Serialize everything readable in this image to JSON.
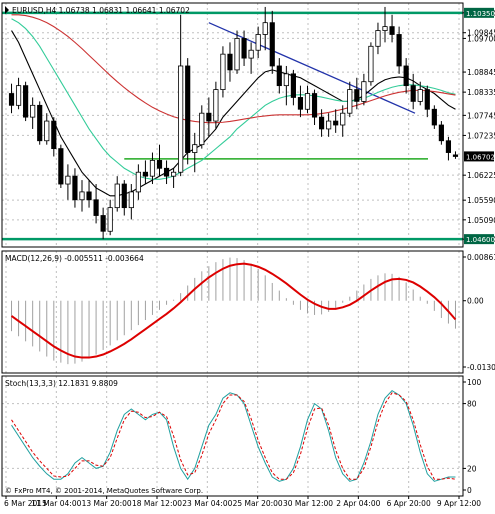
{
  "colors": {
    "background": "#ffffff",
    "frame": "#000000",
    "grid": "#c0c0c0",
    "bull_candle": "#ffffff",
    "bear_candle": "#000000",
    "ma_fast": "#000000",
    "ma_mid": "#33cc99",
    "ma_slow": "#cc3333",
    "trend_line": "#2233aa",
    "horizontal_levels": "#009966",
    "support_line": "#22aa22",
    "macd_histogram": "#a0a0a0",
    "macd_signal": "#dd0000",
    "stoch_main": "#20a0a0",
    "stoch_signal": "#dd0000",
    "price_label_bg": "#006644",
    "price_label_text": "#ffffff"
  },
  "chart_data": [
    {
      "type": "candlestick",
      "title": "EURUSD,H4  1.06738 1.06831 1.06641 1.06702",
      "symbol": "EURUSD",
      "timeframe": "H4",
      "ohlc_last": {
        "open": 1.06738,
        "high": 1.06831,
        "low": 1.06641,
        "close": 1.06702
      },
      "ylim": [
        1.044,
        1.106
      ],
      "yticks": [
        "1.10350",
        "1.09845",
        "1.09700",
        "1.08845",
        "1.08335",
        "1.07745",
        "1.07235",
        "1.06225",
        "1.05590",
        "1.05090",
        "1.04600"
      ],
      "xtick_labels": [
        "6 Mar 2015",
        "11 Mar 04:00",
        "13 Mar 20:00",
        "18 Mar 12:00",
        "23 Mar 04:00",
        "25 Mar 20:00",
        "30 Mar 12:00",
        "2 Apr 04:00",
        "6 Apr 20:00",
        "9 Apr 12:00"
      ],
      "grid": true,
      "horizontal_levels": [
        1.1035,
        1.046
      ],
      "support_level": 1.0664,
      "trend_line": {
        "from": 1.101,
        "to": 1.078
      },
      "candles": [
        [
          1.083,
          1.0855,
          1.078,
          1.08
        ],
        [
          1.08,
          1.087,
          1.079,
          1.085
        ],
        [
          1.085,
          1.086,
          1.076,
          1.077
        ],
        [
          1.077,
          1.082,
          1.074,
          1.08
        ],
        [
          1.08,
          1.081,
          1.07,
          1.071
        ],
        [
          1.071,
          1.078,
          1.07,
          1.076
        ],
        [
          1.076,
          1.077,
          1.067,
          1.069
        ],
        [
          1.069,
          1.07,
          1.059,
          1.06
        ],
        [
          1.06,
          1.065,
          1.056,
          1.062
        ],
        [
          1.062,
          1.064,
          1.054,
          1.056
        ],
        [
          1.056,
          1.061,
          1.053,
          1.058
        ],
        [
          1.058,
          1.061,
          1.054,
          1.056
        ],
        [
          1.056,
          1.06,
          1.05,
          1.052
        ],
        [
          1.052,
          1.054,
          1.046,
          1.048
        ],
        [
          1.048,
          1.056,
          1.047,
          1.054
        ],
        [
          1.054,
          1.062,
          1.053,
          1.06
        ],
        [
          1.06,
          1.061,
          1.052,
          1.054
        ],
        [
          1.054,
          1.06,
          1.051,
          1.058
        ],
        [
          1.058,
          1.065,
          1.056,
          1.063
        ],
        [
          1.063,
          1.066,
          1.06,
          1.062
        ],
        [
          1.062,
          1.068,
          1.06,
          1.066
        ],
        [
          1.066,
          1.07,
          1.062,
          1.064
        ],
        [
          1.064,
          1.066,
          1.06,
          1.062
        ],
        [
          1.062,
          1.064,
          1.059,
          1.063
        ],
        [
          1.063,
          1.103,
          1.062,
          1.09
        ],
        [
          1.09,
          1.092,
          1.065,
          1.068
        ],
        [
          1.068,
          1.073,
          1.063,
          1.07
        ],
        [
          1.07,
          1.08,
          1.069,
          1.078
        ],
        [
          1.078,
          1.082,
          1.072,
          1.076
        ],
        [
          1.076,
          1.086,
          1.074,
          1.084
        ],
        [
          1.084,
          1.095,
          1.082,
          1.093
        ],
        [
          1.093,
          1.096,
          1.086,
          1.089
        ],
        [
          1.089,
          1.099,
          1.088,
          1.097
        ],
        [
          1.097,
          1.099,
          1.09,
          1.092
        ],
        [
          1.092,
          1.096,
          1.088,
          1.094
        ],
        [
          1.094,
          1.1,
          1.092,
          1.098
        ],
        [
          1.098,
          1.105,
          1.094,
          1.101
        ],
        [
          1.101,
          1.104,
          1.088,
          1.09
        ],
        [
          1.09,
          1.092,
          1.083,
          1.085
        ],
        [
          1.085,
          1.09,
          1.08,
          1.088
        ],
        [
          1.088,
          1.089,
          1.08,
          1.082
        ],
        [
          1.082,
          1.085,
          1.077,
          1.079
        ],
        [
          1.079,
          1.085,
          1.078,
          1.083
        ],
        [
          1.083,
          1.084,
          1.075,
          1.077
        ],
        [
          1.077,
          1.079,
          1.072,
          1.074
        ],
        [
          1.074,
          1.078,
          1.072,
          1.076
        ],
        [
          1.076,
          1.079,
          1.073,
          1.075
        ],
        [
          1.075,
          1.08,
          1.072,
          1.078
        ],
        [
          1.078,
          1.086,
          1.077,
          1.084
        ],
        [
          1.084,
          1.087,
          1.079,
          1.081
        ],
        [
          1.081,
          1.088,
          1.08,
          1.086
        ],
        [
          1.086,
          1.096,
          1.085,
          1.095
        ],
        [
          1.095,
          1.101,
          1.093,
          1.099
        ],
        [
          1.099,
          1.105,
          1.096,
          1.1
        ],
        [
          1.1,
          1.103,
          1.096,
          1.098
        ],
        [
          1.098,
          1.1,
          1.088,
          1.09
        ],
        [
          1.09,
          1.092,
          1.083,
          1.085
        ],
        [
          1.085,
          1.088,
          1.079,
          1.081
        ],
        [
          1.081,
          1.086,
          1.08,
          1.084
        ],
        [
          1.084,
          1.085,
          1.077,
          1.079
        ],
        [
          1.079,
          1.08,
          1.074,
          1.075
        ],
        [
          1.075,
          1.076,
          1.07,
          1.071
        ],
        [
          1.071,
          1.072,
          1.066,
          1.068
        ],
        [
          1.0674,
          1.0683,
          1.0664,
          1.067
        ]
      ],
      "overlays": [
        {
          "name": "ma_fast",
          "values": [
            1.099,
            1.096,
            1.092,
            1.088,
            1.084,
            1.08,
            1.076,
            1.072,
            1.069,
            1.066,
            1.063,
            1.061,
            1.059,
            1.058,
            1.057,
            1.057,
            1.0575,
            1.058,
            1.059,
            1.06,
            1.061,
            1.062,
            1.063,
            1.064,
            1.066,
            1.068,
            1.069,
            1.07,
            1.072,
            1.074,
            1.077,
            1.079,
            1.081,
            1.083,
            1.085,
            1.087,
            1.0885,
            1.089,
            1.0885,
            1.088,
            1.0875,
            1.087,
            1.086,
            1.085,
            1.084,
            1.083,
            1.082,
            1.081,
            1.081,
            1.0815,
            1.0825,
            1.084,
            1.0855,
            1.0865,
            1.087,
            1.0872,
            1.087,
            1.0862,
            1.085,
            1.084,
            1.083,
            1.0815,
            1.08,
            1.079
          ]
        },
        {
          "name": "ma_mid",
          "values": [
            1.102,
            1.101,
            1.0995,
            1.0975,
            1.095,
            1.092,
            1.089,
            1.086,
            1.083,
            1.08,
            1.077,
            1.074,
            1.0715,
            1.069,
            1.067,
            1.0655,
            1.064,
            1.063,
            1.062,
            1.0615,
            1.0612,
            1.0612,
            1.0615,
            1.062,
            1.063,
            1.064,
            1.065,
            1.066,
            1.0675,
            1.069,
            1.0705,
            1.072,
            1.074,
            1.0755,
            1.077,
            1.0785,
            1.08,
            1.081,
            1.0818,
            1.0823,
            1.0826,
            1.0827,
            1.0826,
            1.0824,
            1.0821,
            1.0817,
            1.0813,
            1.081,
            1.081,
            1.0813,
            1.0818,
            1.0825,
            1.0833,
            1.084,
            1.0846,
            1.085,
            1.0852,
            1.0852,
            1.085,
            1.0847,
            1.0843,
            1.0838,
            1.0832,
            1.0828
          ]
        },
        {
          "name": "ma_slow",
          "values": [
            1.103,
            1.103,
            1.1028,
            1.1024,
            1.1018,
            1.101,
            1.1,
            1.0988,
            1.0975,
            1.096,
            1.0944,
            1.0927,
            1.091,
            1.0893,
            1.0876,
            1.086,
            1.0845,
            1.0831,
            1.0818,
            1.0806,
            1.0795,
            1.0786,
            1.0778,
            1.0771,
            1.0766,
            1.0762,
            1.0759,
            1.0757,
            1.0756,
            1.0756,
            1.0757,
            1.0759,
            1.0762,
            1.0765,
            1.0768,
            1.0771,
            1.0773,
            1.0775,
            1.0776,
            1.0776,
            1.0776,
            1.0776,
            1.0776,
            1.0777,
            1.0779,
            1.0782,
            1.0786,
            1.079,
            1.0795,
            1.08,
            1.0806,
            1.0812,
            1.0818,
            1.0824,
            1.0829,
            1.0833,
            1.0836,
            1.0838,
            1.0838,
            1.0837,
            1.0835,
            1.0832,
            1.0829,
            1.0826
          ]
        }
      ],
      "price_labels": [
        "1.10350",
        "1.04600",
        "1.06702"
      ]
    },
    {
      "type": "histogram",
      "title": "MACD(12,26,9) -0.005511 -0.003664",
      "ylim": [
        -0.01306,
        0.008617
      ],
      "yticks": [
        "0.008617",
        "0.00",
        "-0.013061"
      ],
      "histogram": [
        -0.006,
        -0.007,
        -0.008,
        -0.009,
        -0.01,
        -0.011,
        -0.0118,
        -0.0122,
        -0.0125,
        -0.0124,
        -0.012,
        -0.0114,
        -0.0106,
        -0.0097,
        -0.0088,
        -0.0078,
        -0.0068,
        -0.0058,
        -0.0048,
        -0.0038,
        -0.0028,
        -0.0018,
        -0.0008,
        0.0002,
        0.0015,
        0.003,
        0.0045,
        0.0058,
        0.0068,
        0.0076,
        0.0082,
        0.0085,
        0.0084,
        0.008,
        0.0073,
        0.0063,
        0.005,
        0.0035,
        0.002,
        0.0005,
        -0.0008,
        -0.0018,
        -0.0025,
        -0.0028,
        -0.0027,
        -0.0022,
        -0.0014,
        -0.0004,
        0.0008,
        0.002,
        0.0032,
        0.0043,
        0.005,
        0.0054,
        0.0053,
        0.0047,
        0.0036,
        0.0022,
        0.0008,
        -0.0006,
        -0.002,
        -0.0034,
        -0.0045,
        -0.0055
      ],
      "signal": [
        -0.003,
        -0.004,
        -0.005,
        -0.006,
        -0.007,
        -0.008,
        -0.009,
        -0.0098,
        -0.0105,
        -0.011,
        -0.0112,
        -0.0112,
        -0.011,
        -0.0106,
        -0.01,
        -0.0093,
        -0.0085,
        -0.0076,
        -0.0066,
        -0.0056,
        -0.0046,
        -0.0036,
        -0.0026,
        -0.0015,
        -0.0003,
        0.001,
        0.0023,
        0.0035,
        0.0046,
        0.0055,
        0.0063,
        0.0069,
        0.0072,
        0.0073,
        0.0071,
        0.0067,
        0.0061,
        0.0053,
        0.0044,
        0.0034,
        0.0023,
        0.0012,
        0.0002,
        -0.0006,
        -0.0012,
        -0.0016,
        -0.0016,
        -0.0013,
        -0.0008,
        0.0,
        0.001,
        0.002,
        0.0029,
        0.0037,
        0.0042,
        0.0043,
        0.0041,
        0.0036,
        0.0028,
        0.0018,
        0.0007,
        -0.0006,
        -0.0021,
        -0.0037
      ]
    },
    {
      "type": "line",
      "title": "Stoch(13,3,3) 12.1831 9.8809",
      "ylim": [
        0,
        100
      ],
      "yticks": [
        "100",
        "80",
        "20",
        "0"
      ],
      "series": [
        {
          "name": "stoch_main",
          "values": [
            60,
            50,
            40,
            30,
            22,
            15,
            10,
            10,
            15,
            25,
            30,
            25,
            20,
            22,
            35,
            55,
            70,
            75,
            70,
            65,
            70,
            72,
            65,
            40,
            20,
            10,
            20,
            40,
            60,
            70,
            85,
            90,
            88,
            80,
            60,
            40,
            25,
            12,
            8,
            10,
            20,
            40,
            65,
            80,
            75,
            55,
            30,
            15,
            8,
            10,
            25,
            45,
            70,
            85,
            92,
            88,
            80,
            60,
            35,
            15,
            8,
            10,
            12,
            12
          ]
        },
        {
          "name": "stoch_signal",
          "values": [
            65,
            55,
            45,
            35,
            27,
            20,
            13,
            12,
            13,
            20,
            27,
            27,
            23,
            22,
            30,
            48,
            65,
            73,
            72,
            67,
            68,
            72,
            68,
            50,
            28,
            14,
            16,
            32,
            52,
            65,
            80,
            88,
            88,
            82,
            66,
            46,
            30,
            16,
            10,
            10,
            16,
            33,
            57,
            75,
            76,
            60,
            37,
            20,
            10,
            10,
            20,
            40,
            63,
            80,
            90,
            88,
            82,
            65,
            42,
            22,
            10,
            10,
            11,
            10
          ]
        }
      ]
    }
  ],
  "copyright": "© FxPro MT4, © 2001-2014, MetaQuotes Software Corp."
}
